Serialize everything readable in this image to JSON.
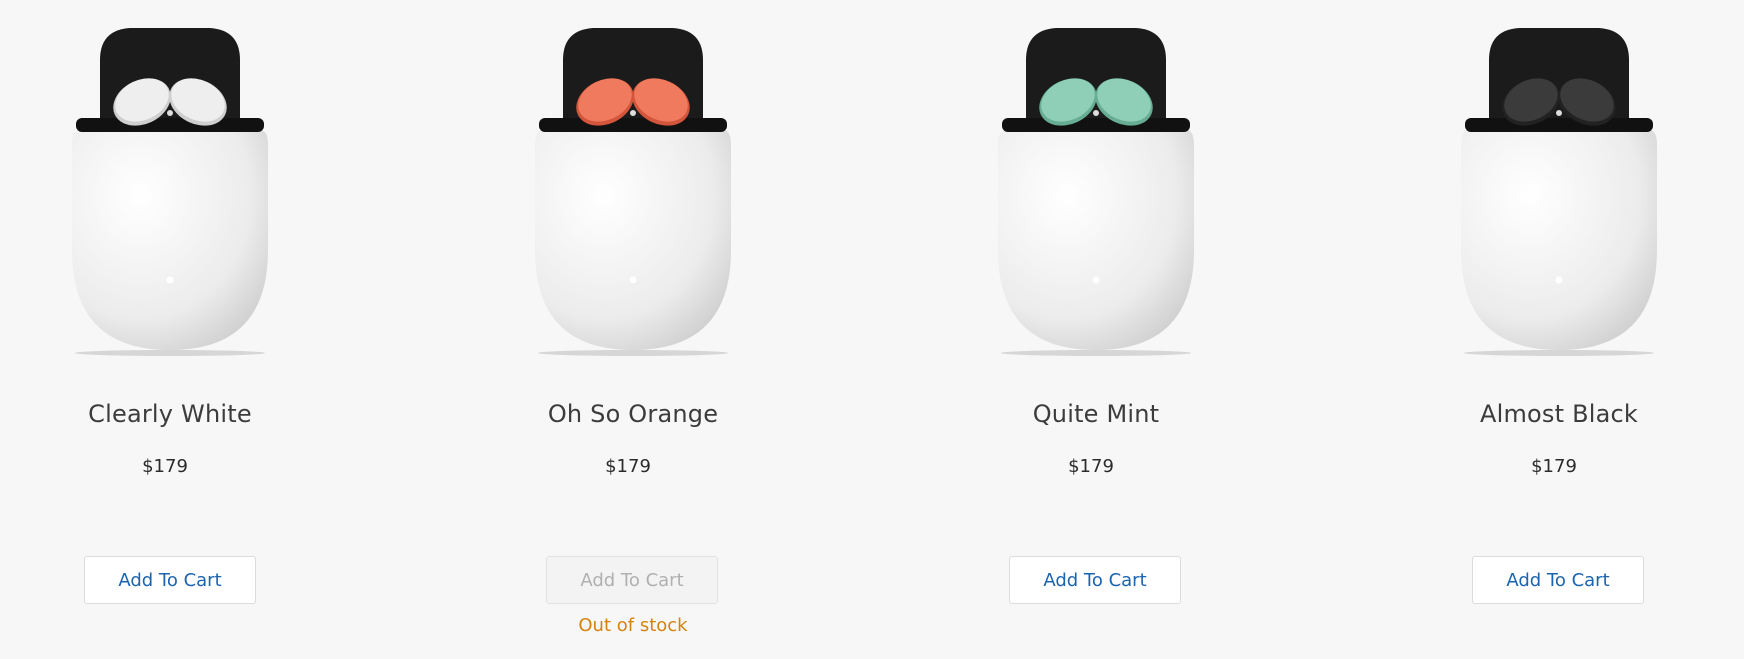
{
  "products": [
    {
      "name": "Clearly White",
      "price": "$179",
      "button": "Add To Cart",
      "bud_color": "#eeeeee",
      "bud_shade": "#cfcfcf",
      "available": true
    },
    {
      "name": "Oh So Orange",
      "price": "$179",
      "button": "Add To Cart",
      "bud_color": "#f07a5e",
      "bud_shade": "#d2553c",
      "available": false,
      "stock_status": "Out of stock"
    },
    {
      "name": "Quite Mint",
      "price": "$179",
      "button": "Add To Cart",
      "bud_color": "#8fcfb8",
      "bud_shade": "#66ad94",
      "available": true
    },
    {
      "name": "Almost Black",
      "price": "$179",
      "button": "Add To Cart",
      "bud_color": "#3b3b3b",
      "bud_shade": "#222222",
      "available": true
    }
  ],
  "colors": {
    "button_text": "#1a64b0",
    "out_of_stock": "#d4830d",
    "background": "#f7f7f7"
  }
}
